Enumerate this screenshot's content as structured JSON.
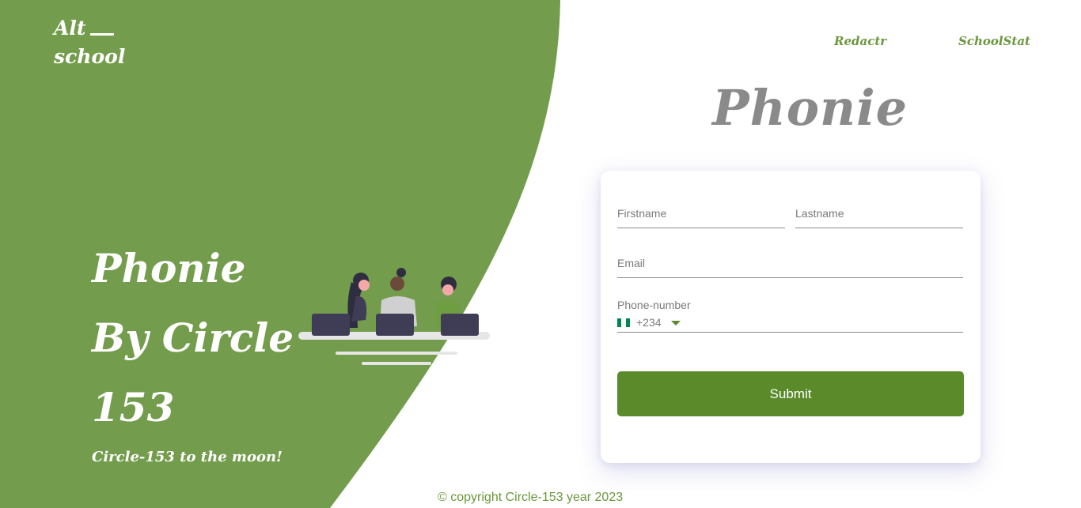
{
  "header": {
    "logo_line1": "Alt",
    "logo_line2": "school",
    "nav": [
      "Redactr",
      "SchoolStat"
    ]
  },
  "hero": {
    "title": "Phonie By Circle 153",
    "subtitle": "Circle-153 to the moon!"
  },
  "brand": "Phonie",
  "form": {
    "firstname_label": "Firstname",
    "lastname_label": "Lastname",
    "email_label": "Email",
    "phone_label": "Phone-number",
    "phone_code": "+234",
    "submit_label": "Submit"
  },
  "footer": "© copyright Circle-153 year 2023",
  "colors": {
    "green": "#739d4c",
    "accent": "#5a8a2a",
    "flag_green": "#008751"
  },
  "icons": [
    "nigeria-flag-icon",
    "chevron-down-icon",
    "team-illustration"
  ]
}
